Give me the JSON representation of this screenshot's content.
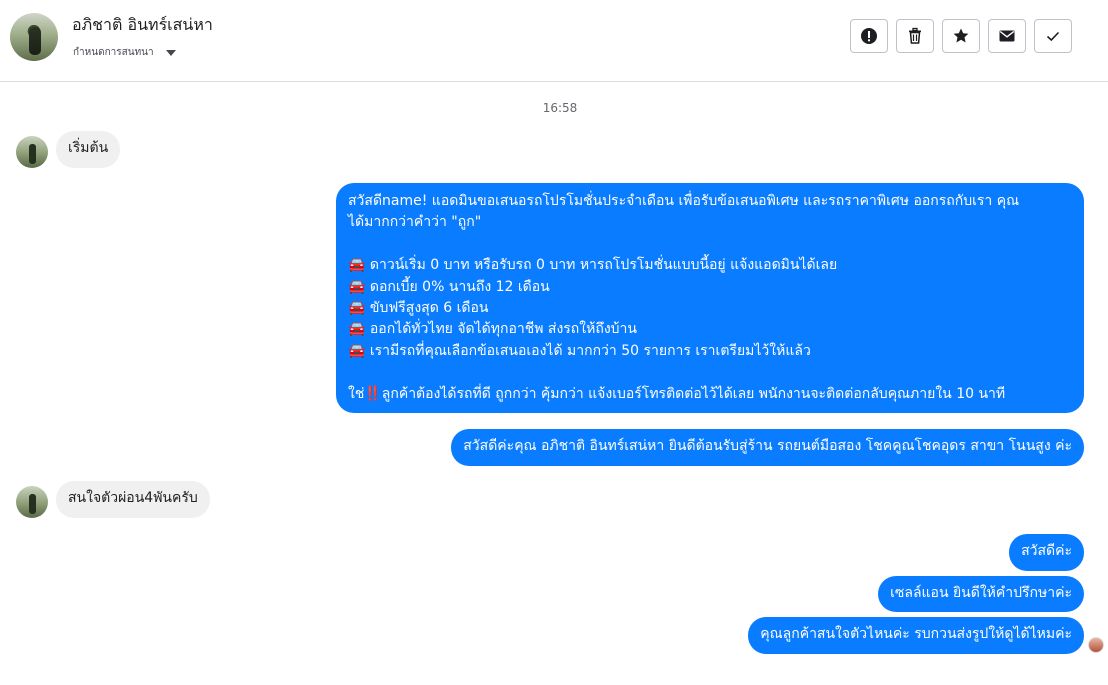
{
  "header": {
    "contact_name": "อภิชาติ อินทร์เสน่หา",
    "manage_label": "กำหนดการสนทนา",
    "buttons": {
      "alert": "alert-icon",
      "delete": "trash-icon",
      "star": "star-icon",
      "mail": "mail-icon",
      "done": "check-icon"
    }
  },
  "chat": {
    "timestamp": "16:58",
    "messages": [
      {
        "from": "contact",
        "text": "เริ่มต้น"
      },
      {
        "from": "page",
        "lines": [
          "สวัสดีname! แอดมินขอเสนอรถโปรโมชั่นประจำเดือน เพื่อรับข้อเสนอพิเศษ และรถราคาพิเศษ ออกรถกับเรา คุณ",
          "ได้มากกว่าคำว่า \"ถูก\"",
          "",
          "🚘 ดาวน์เริ่ม 0 บาท หรือรับรถ 0 บาท หารถโปรโมชั่นแบบนี้อยู่ แจ้งแอดมินได้เลย",
          "🚘 ดอกเบี้ย 0% นานถึง 12 เดือน",
          "🚘 ขับฟรีสูงสุด 6 เดือน",
          "🚘 ออกได้ทั่วไทย จัดได้ทุกอาชีพ ส่งรถให้ถึงบ้าน",
          "🚘 เรามีรถที่คุณเลือกข้อเสนอเองได้ มากกว่า 50 รายการ เราเตรียมไว้ให้แล้ว",
          "",
          "ใช่‼️ลูกค้าต้องได้รถที่ดี ถูกกว่า คุ้มกว่า แจ้งเบอร์โทรติดต่อไว้ได้เลย พนักงานจะติดต่อกลับคุณภายใน 10 นาที"
        ]
      },
      {
        "from": "page",
        "text": "สวัสดีค่ะคุณ อภิชาติ อินทร์เสน่หา ยินดีต้อนรับสู่ร้าน รถยนต์มือสอง โชคคูณโชคอุดร สาขา โนนสูง ค่ะ"
      },
      {
        "from": "contact",
        "text": "สนใจตัวผ่อน4พันครับ"
      },
      {
        "from": "page",
        "text": "สวัสดีค่ะ"
      },
      {
        "from": "page",
        "text": "เซลล์แอน ยินดีให้คำปรึกษาค่ะ"
      },
      {
        "from": "page",
        "text": "คุณลูกค้าสนใจตัวไหนค่ะ รบกวนส่งรูปให้ดูได้ไหมค่ะ"
      }
    ]
  },
  "colors": {
    "outgoing_bubble": "#0a7cff",
    "incoming_bubble": "#f0f0f0",
    "divider": "#dadde1"
  }
}
